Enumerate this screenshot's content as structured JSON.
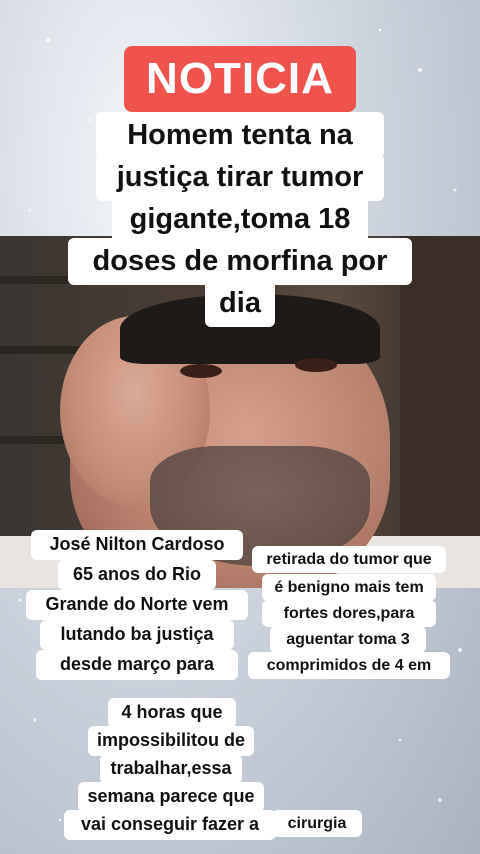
{
  "badge": {
    "label": "NOTICIA",
    "color": "#f0524c"
  },
  "headline": {
    "lines": [
      "Homem tenta na",
      "justiça tirar tumor",
      "gigante,toma 18",
      "doses de morfina por",
      "dia"
    ]
  },
  "captions": {
    "left": [
      "José Nilton Cardoso",
      "65 anos do Rio",
      "Grande do Norte vem",
      "lutando ba justiça",
      "desde março para"
    ],
    "right": [
      "retirada do tumor que",
      "é benigno mais tem",
      "fortes dores,para",
      "aguentar toma 3",
      "comprimidos de 4 em"
    ],
    "bottom": [
      "4 horas que",
      "impossibilitou de",
      "trabalhar,essa",
      "semana parece que",
      "vai conseguir fazer a"
    ],
    "last": "cirurgia"
  }
}
